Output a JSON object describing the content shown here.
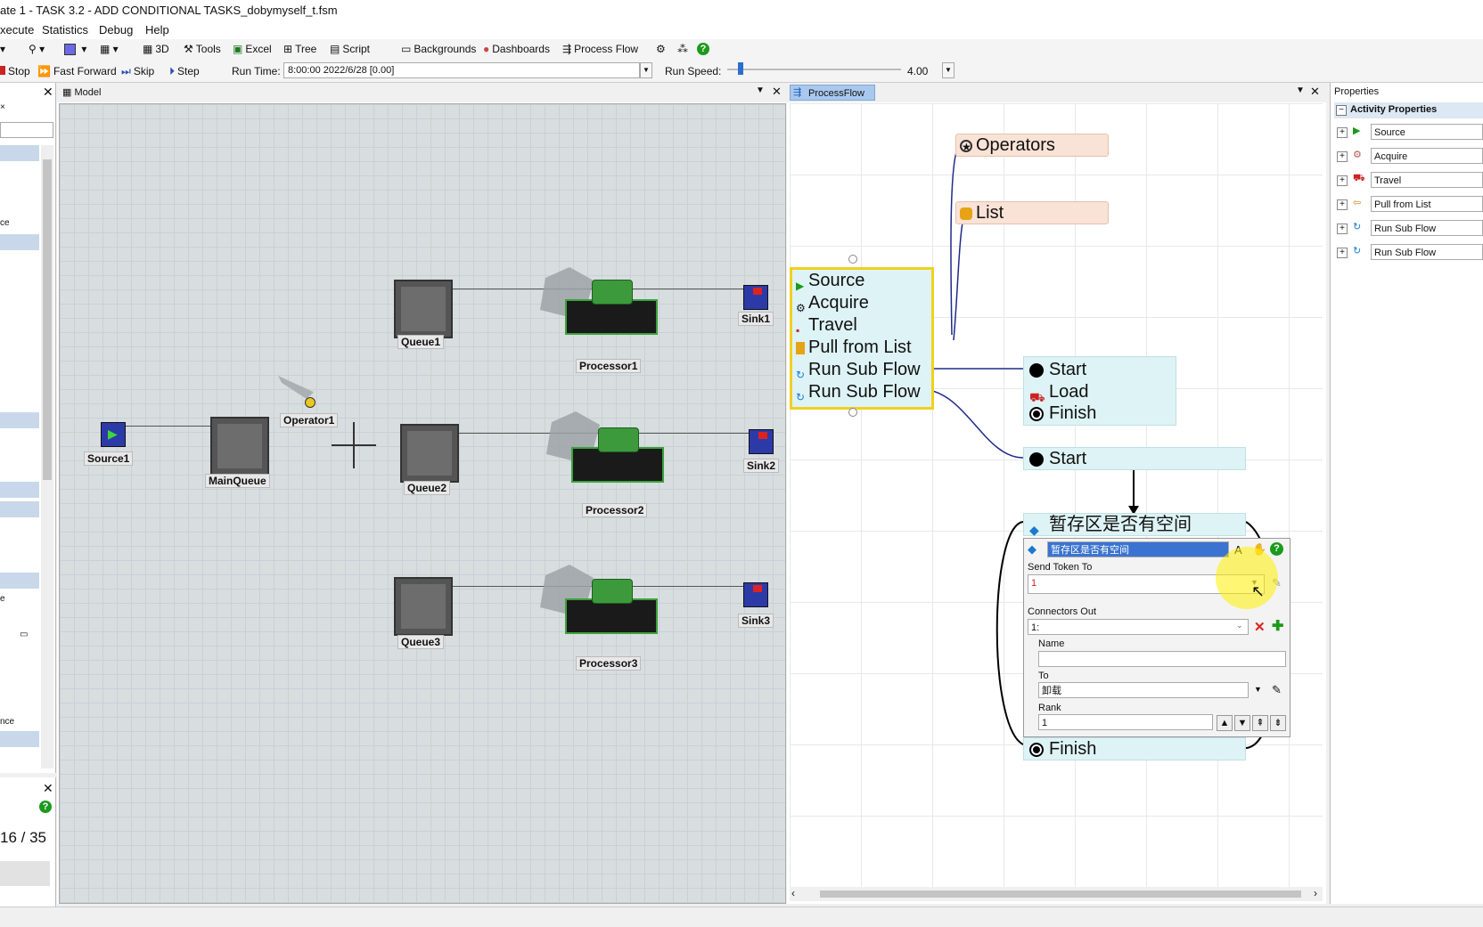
{
  "window": {
    "title": "ate 1 - TASK 3.2 - ADD CONDITIONAL TASKS_dobymyself_t.fsm"
  },
  "menu": {
    "items": [
      "xecute",
      "Statistics",
      "Debug",
      "Help"
    ]
  },
  "toolbar": {
    "items": [
      "3D",
      "Tools",
      "Excel",
      "Tree",
      "Script",
      "Backgrounds",
      "Dashboards",
      "Process Flow"
    ]
  },
  "runbar": {
    "stop": "Stop",
    "fast_forward": "Fast Forward",
    "skip": "Skip",
    "step": "Step",
    "run_time_label": "Run Time:",
    "run_time_value": "8:00:00  2022/6/28  [0.00]",
    "run_speed_label": "Run Speed:",
    "run_speed_value": "4.00"
  },
  "left_panel": {
    "labels": [
      "ce",
      "e",
      "nce"
    ],
    "counter": "16 / 35"
  },
  "model": {
    "tab": "Model",
    "objects": {
      "source1": "Source1",
      "mainqueue": "MainQueue",
      "operator1": "Operator1",
      "queue1": "Queue1",
      "queue2": "Queue2",
      "queue3": "Queue3",
      "processor1": "Processor1",
      "processor2": "Processor2",
      "processor3": "Processor3",
      "sink1": "Sink1",
      "sink2": "Sink2",
      "sink3": "Sink3"
    }
  },
  "processflow": {
    "tab": "ProcessFlow",
    "resources": {
      "operators": "Operators",
      "list": "List"
    },
    "source_block": [
      "Source",
      "Acquire",
      "Travel",
      "Pull from List",
      "Run Sub Flow",
      "Run Sub Flow"
    ],
    "sub_block_1": [
      "Start",
      "Load",
      "Finish"
    ],
    "sub_block_2": {
      "start": "Start",
      "decide": "暂存区是否有空间",
      "finish": "Finish"
    },
    "quick_props": {
      "name_value": "暂存区是否有空间",
      "send_token_label": "Send Token To",
      "send_token_value": "1",
      "connectors_out_label": "Connectors Out",
      "connectors_out_value": "1:",
      "name_label": "Name",
      "name_value_field": "",
      "to_label": "To",
      "to_value": "卸载",
      "rank_label": "Rank",
      "rank_value": "1"
    }
  },
  "properties": {
    "title": "Properties",
    "section": "Activity Properties",
    "rows": [
      "Source",
      "Acquire",
      "Travel",
      "Pull from List",
      "Run Sub Flow",
      "Run Sub Flow"
    ]
  }
}
